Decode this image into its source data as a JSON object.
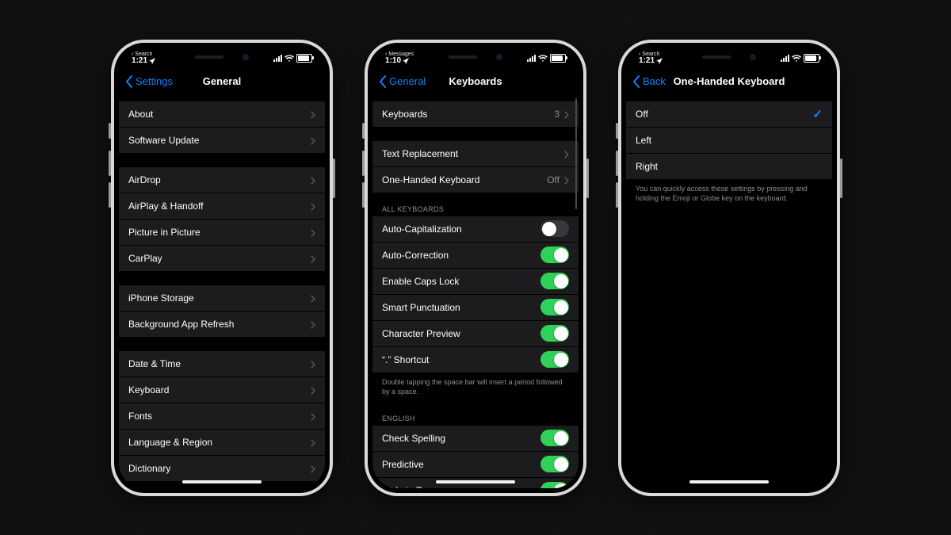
{
  "colors": {
    "accent": "#0a84ff",
    "toggleOn": "#30d158"
  },
  "phone1": {
    "statusBreadcrumb": "Search",
    "time": "1:21",
    "back": "Settings",
    "title": "General",
    "groups": [
      {
        "rows": [
          {
            "label": "About",
            "chevron": true
          },
          {
            "label": "Software Update",
            "chevron": true
          }
        ]
      },
      {
        "rows": [
          {
            "label": "AirDrop",
            "chevron": true
          },
          {
            "label": "AirPlay & Handoff",
            "chevron": true
          },
          {
            "label": "Picture in Picture",
            "chevron": true
          },
          {
            "label": "CarPlay",
            "chevron": true
          }
        ]
      },
      {
        "rows": [
          {
            "label": "iPhone Storage",
            "chevron": true
          },
          {
            "label": "Background App Refresh",
            "chevron": true
          }
        ]
      },
      {
        "rows": [
          {
            "label": "Date & Time",
            "chevron": true
          },
          {
            "label": "Keyboard",
            "chevron": true
          },
          {
            "label": "Fonts",
            "chevron": true
          },
          {
            "label": "Language & Region",
            "chevron": true
          },
          {
            "label": "Dictionary",
            "chevron": true
          }
        ]
      }
    ]
  },
  "phone2": {
    "statusBreadcrumb": "Messages",
    "time": "1:10",
    "back": "General",
    "title": "Keyboards",
    "groups": [
      {
        "rows": [
          {
            "label": "Keyboards",
            "detail": "3",
            "chevron": true
          }
        ]
      },
      {
        "rows": [
          {
            "label": "Text Replacement",
            "chevron": true
          },
          {
            "label": "One-Handed Keyboard",
            "detail": "Off",
            "chevron": true
          }
        ]
      },
      {
        "header": "ALL KEYBOARDS",
        "rows": [
          {
            "label": "Auto-Capitalization",
            "toggle": false
          },
          {
            "label": "Auto-Correction",
            "toggle": true
          },
          {
            "label": "Enable Caps Lock",
            "toggle": true
          },
          {
            "label": "Smart Punctuation",
            "toggle": true
          },
          {
            "label": "Character Preview",
            "toggle": true
          },
          {
            "label": "“.” Shortcut",
            "toggle": true
          }
        ],
        "footer": "Double tapping the space bar will insert a period followed by a space."
      },
      {
        "header": "ENGLISH",
        "rows": [
          {
            "label": "Check Spelling",
            "toggle": true
          },
          {
            "label": "Predictive",
            "toggle": true
          },
          {
            "label": "Slide to Type",
            "toggle": true
          }
        ]
      }
    ]
  },
  "phone3": {
    "statusBreadcrumb": "Search",
    "time": "1:21",
    "back": "Back",
    "title": "One-Handed Keyboard",
    "groups": [
      {
        "rows": [
          {
            "label": "Off",
            "checked": true
          },
          {
            "label": "Left"
          },
          {
            "label": "Right"
          }
        ],
        "footer": "You can quickly access these settings by pressing and holding the Emoji or Globe key on the keyboard."
      }
    ]
  }
}
